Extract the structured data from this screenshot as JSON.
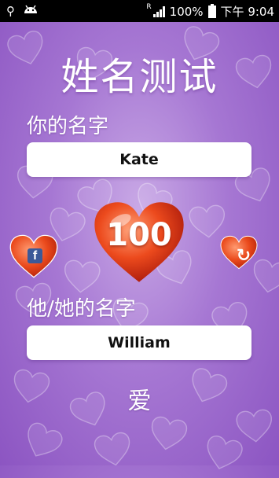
{
  "status_bar": {
    "battery": "100%",
    "time": "下午 9:04",
    "roaming": "R",
    "icons": [
      "usb-icon",
      "android-icon",
      "signal-icon",
      "battery-icon"
    ]
  },
  "title": "姓名测试",
  "your_name": {
    "label": "你的名字",
    "value": "Kate"
  },
  "score": "100",
  "partner_name": {
    "label": "他/她的名字",
    "value": "William"
  },
  "result": "爱",
  "buttons": {
    "share_icon": "facebook-icon",
    "refresh_icon": "refresh-icon"
  },
  "colors": {
    "background": "#a677d3",
    "heart_red": "#e8401c",
    "facebook": "#3b5998"
  }
}
